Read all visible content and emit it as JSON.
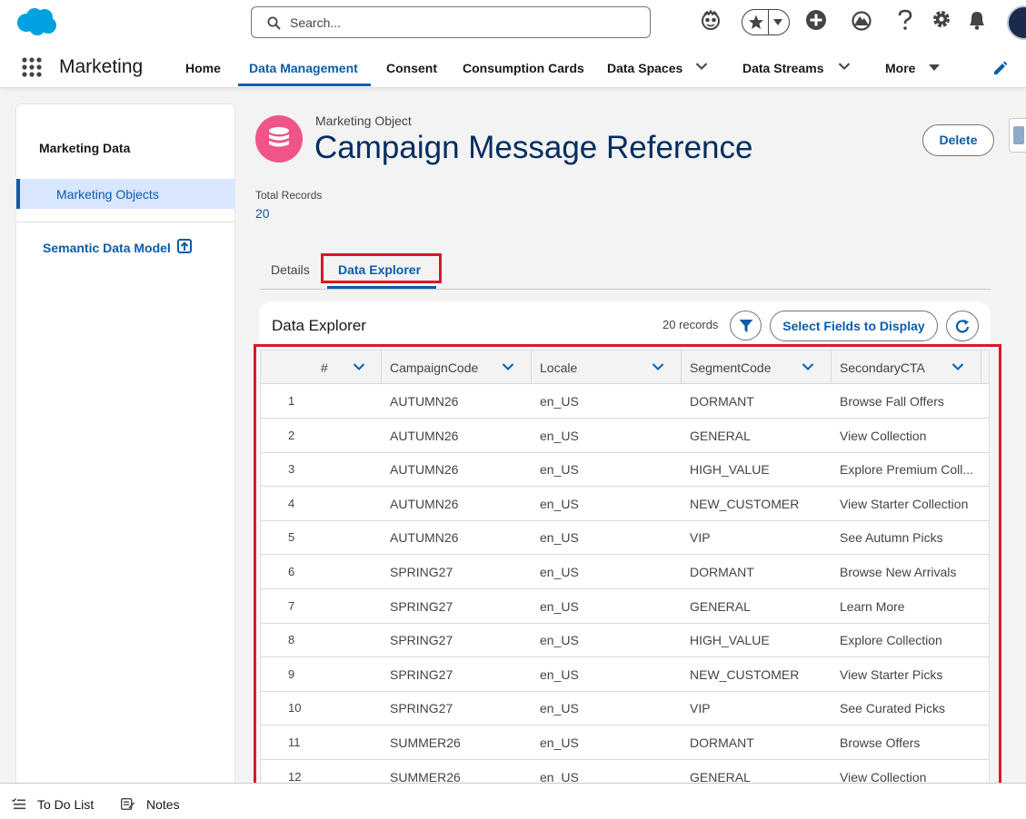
{
  "header": {
    "search_placeholder": "Search...",
    "icons": [
      "salesforce-logo",
      "search-icon",
      "einstein-icon",
      "favorites-star-icon",
      "add-icon",
      "trailhead-icon",
      "help-icon",
      "gear-icon",
      "bell-icon",
      "avatar"
    ]
  },
  "nav": {
    "app_name": "Marketing",
    "items": [
      {
        "label": "Home"
      },
      {
        "label": "Data Management",
        "active": true
      },
      {
        "label": "Consent"
      },
      {
        "label": "Consumption Cards"
      },
      {
        "label": "Data Spaces"
      },
      {
        "label": "Data Streams"
      },
      {
        "label": "More"
      }
    ]
  },
  "sidebar": {
    "title": "Marketing Data",
    "active_item": "Marketing Objects",
    "link": "Semantic Data Model"
  },
  "object": {
    "type": "Marketing Object",
    "title": "Campaign Message Reference",
    "delete_label": "Delete",
    "total_records_label": "Total Records",
    "total_records_value": "20"
  },
  "tabs": {
    "details": "Details",
    "data_explorer": "Data Explorer"
  },
  "explorer": {
    "title": "Data Explorer",
    "record_count": "20 records",
    "select_fields_label": "Select Fields to Display",
    "columns": [
      "#",
      "CampaignCode",
      "Locale",
      "SegmentCode",
      "SecondaryCTA"
    ],
    "rows": [
      [
        "1",
        "AUTUMN26",
        "en_US",
        "DORMANT",
        "Browse Fall Offers"
      ],
      [
        "2",
        "AUTUMN26",
        "en_US",
        "GENERAL",
        "View Collection"
      ],
      [
        "3",
        "AUTUMN26",
        "en_US",
        "HIGH_VALUE",
        "Explore Premium Coll..."
      ],
      [
        "4",
        "AUTUMN26",
        "en_US",
        "NEW_CUSTOMER",
        "View Starter Collection"
      ],
      [
        "5",
        "AUTUMN26",
        "en_US",
        "VIP",
        "See Autumn Picks"
      ],
      [
        "6",
        "SPRING27",
        "en_US",
        "DORMANT",
        "Browse New Arrivals"
      ],
      [
        "7",
        "SPRING27",
        "en_US",
        "GENERAL",
        "Learn More"
      ],
      [
        "8",
        "SPRING27",
        "en_US",
        "HIGH_VALUE",
        "Explore Collection"
      ],
      [
        "9",
        "SPRING27",
        "en_US",
        "NEW_CUSTOMER",
        "View Starter Picks"
      ],
      [
        "10",
        "SPRING27",
        "en_US",
        "VIP",
        "See Curated Picks"
      ],
      [
        "11",
        "SUMMER26",
        "en_US",
        "DORMANT",
        "Browse Offers"
      ],
      [
        "12",
        "SUMMER26",
        "en_US",
        "GENERAL",
        "View Collection"
      ]
    ]
  },
  "utility": {
    "todo": "To Do List",
    "notes": "Notes"
  },
  "colors": {
    "brand_blue": "#0b5cab",
    "title_navy": "#032d60",
    "object_icon": "#f0558a",
    "highlight_red": "#d9182a",
    "salesforce_cloud": "#00a1e0"
  }
}
